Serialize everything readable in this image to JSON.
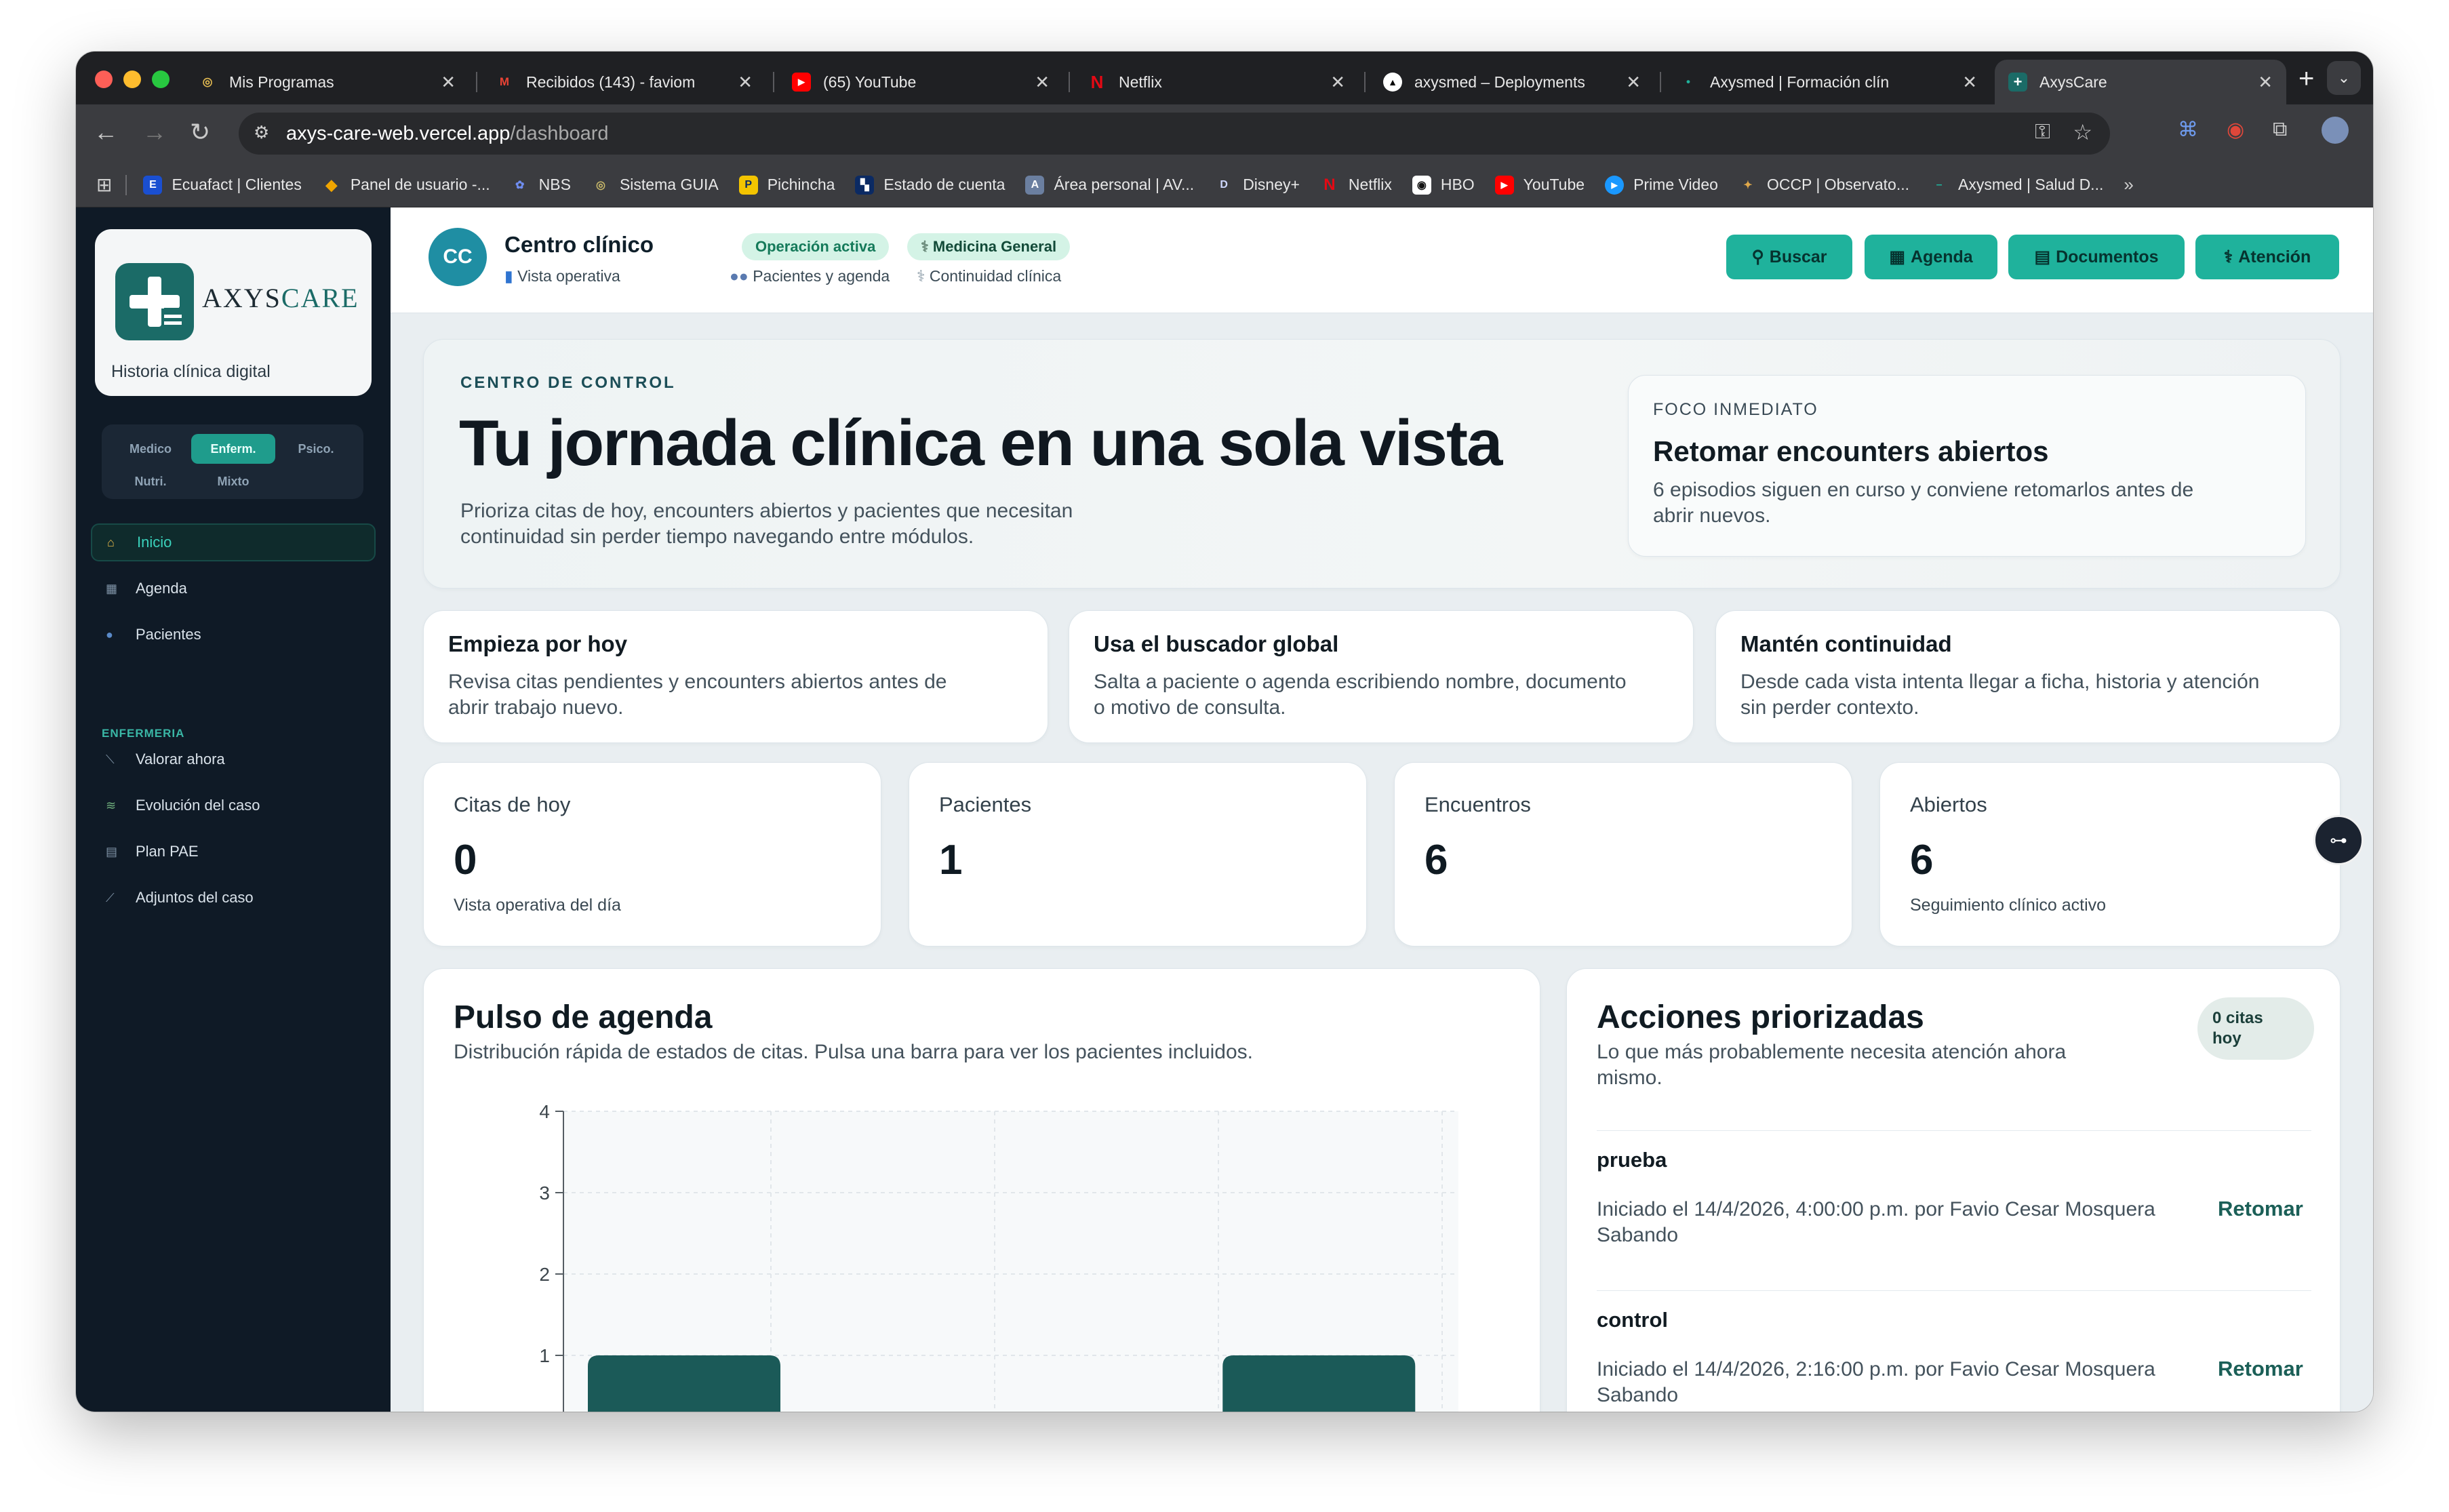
{
  "browser": {
    "tabs": [
      {
        "title": "Mis Programas",
        "icon": "program-icon",
        "color": "#3b3c40",
        "glyph": "◎"
      },
      {
        "title": "Recibidos (143) - faviom",
        "icon": "gmail-icon",
        "color": "#ea4335",
        "glyph": "M"
      },
      {
        "title": "(65) YouTube",
        "icon": "youtube-icon",
        "color": "#ff0000",
        "glyph": "▶"
      },
      {
        "title": "Netflix",
        "icon": "netflix-icon",
        "color": "#e50914",
        "glyph": "N"
      },
      {
        "title": "axysmed – Deployments",
        "icon": "vercel-icon",
        "color": "#000000",
        "glyph": "▲"
      },
      {
        "title": "Axysmed | Formación clín",
        "icon": "dot-icon",
        "color": "#1fb29c",
        "glyph": "•"
      },
      {
        "title": "AxysCare",
        "icon": "axyscare-icon",
        "color": "#1b6b67",
        "glyph": "+"
      }
    ],
    "url_host": "axys-care-web.vercel.app",
    "url_path": "/dashboard",
    "bookmarks": [
      {
        "label": "Ecuafact | Clientes",
        "icon": "ecuafact-icon",
        "color": "#1a4fd1",
        "glyph": "E"
      },
      {
        "label": "Panel de usuario -...",
        "icon": "diamond-icon",
        "color": "#f0a500",
        "glyph": "◆"
      },
      {
        "label": "NBS",
        "icon": "nbs-icon",
        "color": "#3b5cc4",
        "glyph": "N"
      },
      {
        "label": "Sistema GUIA",
        "icon": "guia-icon",
        "color": "#7a8b2c",
        "glyph": "G"
      },
      {
        "label": "Pichincha",
        "icon": "pichincha-icon",
        "color": "#f3c400",
        "glyph": "P"
      },
      {
        "label": "Estado de cuenta",
        "icon": "statement-icon",
        "color": "#0b2a63",
        "glyph": "S"
      },
      {
        "label": "Área personal | AV...",
        "icon": "av-icon",
        "color": "#6b7fa0",
        "glyph": "A"
      },
      {
        "label": "Disney+",
        "icon": "disney-icon",
        "color": "#3b3c40",
        "glyph": "D"
      },
      {
        "label": "Netflix",
        "icon": "netflix-icon",
        "color": "#e50914",
        "glyph": "N"
      },
      {
        "label": "HBO",
        "icon": "hbo-icon",
        "color": "#111111",
        "glyph": "H"
      },
      {
        "label": "YouTube",
        "icon": "youtube-icon",
        "color": "#ff0000",
        "glyph": "▶"
      },
      {
        "label": "Prime Video",
        "icon": "prime-icon",
        "color": "#1a98ff",
        "glyph": "▶"
      },
      {
        "label": "OCCP | Observato...",
        "icon": "occp-icon",
        "color": "#c48a2c",
        "glyph": "O"
      },
      {
        "label": "Axysmed | Salud D...",
        "icon": "axysmed-icon",
        "color": "#1fb29c",
        "glyph": "–"
      }
    ]
  },
  "sidebar": {
    "brand_a": "AXYS",
    "brand_b": "CARE",
    "subtitle": "Historia clínica digital",
    "roles": [
      "Medico",
      "Enferm.",
      "Psico.",
      "Nutri.",
      "Mixto"
    ],
    "nav": [
      {
        "label": "Inicio",
        "icon": "home-icon"
      },
      {
        "label": "Agenda",
        "icon": "calendar-icon"
      },
      {
        "label": "Pacientes",
        "icon": "user-icon"
      }
    ],
    "section_label": "ENFERMERIA",
    "section_items": [
      {
        "label": "Valorar ahora",
        "icon": "assess-icon"
      },
      {
        "label": "Evolución del caso",
        "icon": "notes-icon"
      },
      {
        "label": "Plan PAE",
        "icon": "clipboard-icon"
      },
      {
        "label": "Adjuntos del caso",
        "icon": "paperclip-icon"
      }
    ]
  },
  "header": {
    "avatar": "CC",
    "title": "Centro clínico",
    "pill_status": "Operación activa",
    "pill_specialty": "Medicina General",
    "meta": [
      "Vista operativa",
      "Pacientes y agenda",
      "Continuidad clínica"
    ],
    "buttons": [
      "Buscar",
      "Agenda",
      "Documentos",
      "Atención"
    ]
  },
  "hero": {
    "eyebrow": "CENTRO DE CONTROL",
    "title": "Tu jornada clínica en una sola vista",
    "desc_1": "Prioriza citas de hoy, encounters abiertos y pacientes que necesitan",
    "desc_2": "continuidad sin perder tiempo navegando entre módulos.",
    "focus_eyebrow": "FOCO INMEDIATO",
    "focus_title": "Retomar encounters abiertos",
    "focus_desc_1": "6 episodios siguen en curso y conviene retomarlos antes de",
    "focus_desc_2": "abrir nuevos."
  },
  "tips": [
    {
      "title": "Empieza por hoy",
      "line1": "Revisa citas pendientes y encounters abiertos antes de",
      "line2": "abrir trabajo nuevo."
    },
    {
      "title": "Usa el buscador global",
      "line1": "Salta a paciente o agenda escribiendo nombre, documento",
      "line2": "o motivo de consulta."
    },
    {
      "title": "Mantén continuidad",
      "line1": "Desde cada vista intenta llegar a ficha, historia y atención",
      "line2": "sin perder contexto."
    }
  ],
  "stats": [
    {
      "label": "Citas de hoy",
      "value": "0",
      "note": "Vista operativa del día"
    },
    {
      "label": "Pacientes",
      "value": "1",
      "note": ""
    },
    {
      "label": "Encuentros",
      "value": "6",
      "note": ""
    },
    {
      "label": "Abiertos",
      "value": "6",
      "note": "Seguimiento clínico activo"
    }
  ],
  "agenda": {
    "title": "Pulso de agenda",
    "subtitle": "Distribución rápida de estados de citas. Pulsa una barra para ver los pacientes incluidos."
  },
  "chart_data": {
    "type": "bar",
    "categories": [
      "",
      ""
    ],
    "values": [
      1,
      1
    ],
    "ylim": [
      0,
      4
    ],
    "yticks": [
      "1",
      "2",
      "3",
      "4"
    ],
    "grid": true,
    "bar_color": "#1b5a58"
  },
  "actions": {
    "title": "Acciones priorizadas",
    "subtitle_1": "Lo que más probablemente necesita atención ahora",
    "subtitle_2": "mismo.",
    "badge_1": "0 citas",
    "badge_2": "hoy",
    "items": [
      {
        "name": "prueba",
        "line1": "Iniciado el 14/4/2026, 4:00:00 p.m. por Favio Cesar Mosquera",
        "line2": "Sabando",
        "cta": "Retomar"
      },
      {
        "name": "control",
        "line1": "Iniciado el 14/4/2026, 2:16:00 p.m. por Favio Cesar Mosquera",
        "line2": "Sabando",
        "cta": "Retomar"
      }
    ]
  }
}
